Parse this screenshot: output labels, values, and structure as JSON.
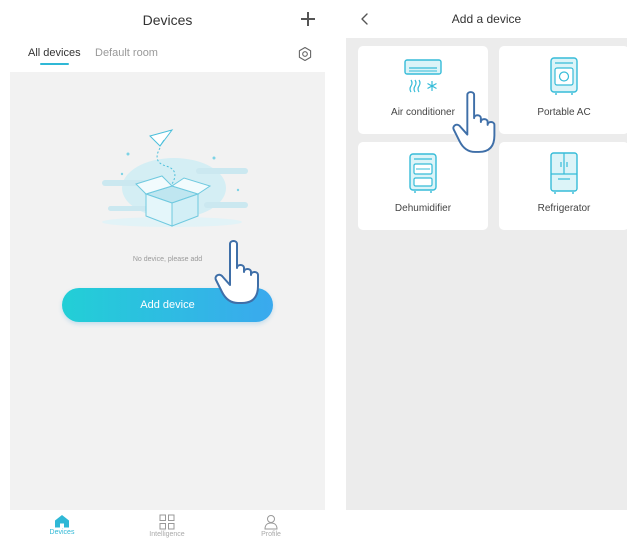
{
  "left": {
    "title": "Devices",
    "tabs": [
      {
        "label": "All devices",
        "active": true
      },
      {
        "label": "Default room",
        "active": false
      }
    ],
    "empty_text": "No device, please add",
    "add_button": "Add device",
    "nav": [
      {
        "label": "Devices",
        "icon": "home-icon",
        "active": true
      },
      {
        "label": "Intelligence",
        "icon": "grid-icon",
        "active": false
      },
      {
        "label": "Profile",
        "icon": "person-icon",
        "active": false
      }
    ]
  },
  "right": {
    "title": "Add a device",
    "devices": [
      {
        "label": "Air conditioner",
        "icon": "air-conditioner-icon"
      },
      {
        "label": "Portable AC",
        "icon": "portable-ac-icon"
      },
      {
        "label": "Dehumidifier",
        "icon": "dehumidifier-icon"
      },
      {
        "label": "Refrigerator",
        "icon": "refrigerator-icon"
      }
    ]
  },
  "colors": {
    "accent": "#2fb8d6",
    "button_gradient_start": "#22cfd6",
    "button_gradient_end": "#3aa9ee",
    "content_background": "#f2f2f2"
  }
}
